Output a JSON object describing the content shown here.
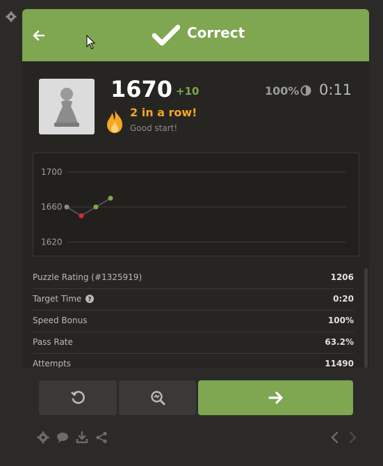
{
  "header": {
    "title": "Correct",
    "back_icon": "arrow-left-icon",
    "status_icon": "check-icon"
  },
  "player": {
    "avatar_icon": "pawn-icon",
    "rating": "1670",
    "rating_delta": "+10",
    "accuracy": "100%",
    "timer": "0:11",
    "streak": "2 in a row!",
    "streak_sub": "Good start!"
  },
  "chart_data": {
    "type": "line",
    "title": "",
    "xlabel": "",
    "ylabel": "",
    "ylim": [
      1610,
      1715
    ],
    "yticks": [
      1700,
      1660,
      1620
    ],
    "x": [
      1,
      2,
      3,
      4
    ],
    "values": [
      1660,
      1650,
      1660,
      1670
    ],
    "point_colors": [
      "#8a8a8a",
      "#c93232",
      "#7fa650",
      "#7fa650"
    ],
    "grid": true
  },
  "stats": [
    {
      "label": "Puzzle Rating (#1325919)",
      "value": "1206"
    },
    {
      "label": "Target Time",
      "value": "0:20",
      "help": true
    },
    {
      "label": "Speed Bonus",
      "value": "100%"
    },
    {
      "label": "Pass Rate",
      "value": "63.2%"
    },
    {
      "label": "Attempts",
      "value": "11490"
    }
  ],
  "colors": {
    "accent_green": "#7fa650",
    "streak_orange": "#f5a623",
    "panel_bg": "#262522"
  }
}
